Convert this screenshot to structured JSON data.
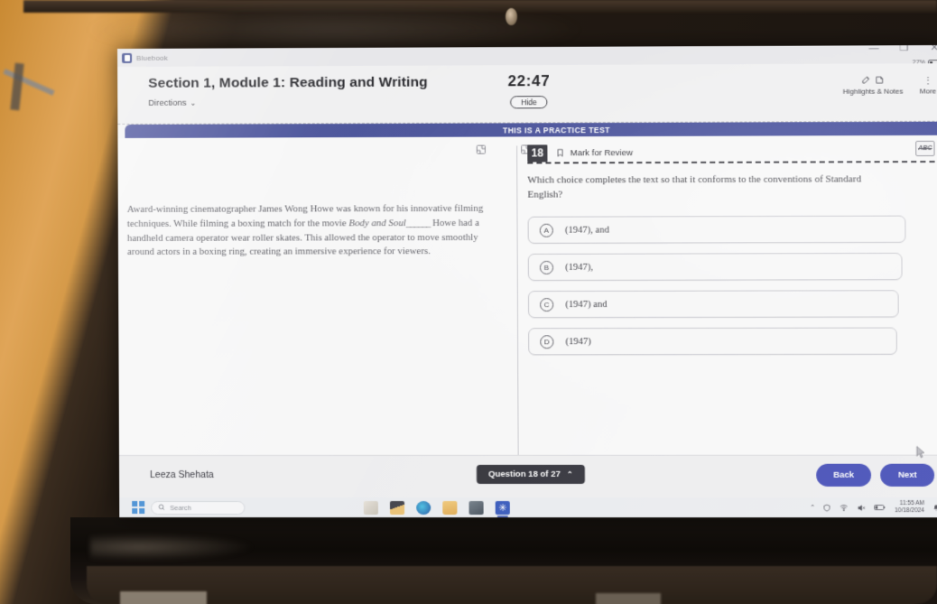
{
  "window": {
    "app_title": "Bluebook",
    "app_logo_icon": "bluebook-logo-icon",
    "minimize_label": "—",
    "maximize_label": "❐",
    "close_label": "✕",
    "battery_percent": "27%"
  },
  "header": {
    "section_title": "Section 1, Module 1: Reading and Writing",
    "directions_label": "Directions",
    "directions_chevron": "⌄",
    "timer": "22:47",
    "hide_label": "Hide",
    "highlights_notes_label": "Highlights & Notes",
    "highlights_icon": "highlighter-icon",
    "notes_icon": "note-icon",
    "more_label": "More",
    "more_icon": "more-vertical-icon"
  },
  "banner": {
    "text": "THIS IS A PRACTICE TEST"
  },
  "panes": {
    "expand_left_icon": "expand-panel-icon",
    "expand_right_icon": "collapse-panel-icon"
  },
  "passage": {
    "part1": "Award-winning cinematographer James Wong Howe was known for his innovative filming techniques. While filming a boxing match for the movie ",
    "italic1": "Body and Soul",
    "blank": "______",
    "part2": " Howe had a handheld camera operator wear roller skates. This allowed the operator to move smoothly around actors in a boxing ring, creating an immersive experience for viewers."
  },
  "question": {
    "number": "18",
    "mark_for_review_label": "Mark for Review",
    "bookmark_icon": "bookmark-icon",
    "abc_tool_label": "ABC",
    "abc_tool_icon": "strikethrough-abc-icon",
    "prompt": "Which choice completes the text so that it conforms to the conventions of Standard English?",
    "choices": [
      {
        "letter": "A",
        "text": "(1947), and"
      },
      {
        "letter": "B",
        "text": "(1947),"
      },
      {
        "letter": "C",
        "text": "(1947) and"
      },
      {
        "letter": "D",
        "text": "(1947)"
      }
    ]
  },
  "footer": {
    "student_name": "Leeza Shehata",
    "question_counter": "Question 18 of 27",
    "counter_chevron": "⌃",
    "back_label": "Back",
    "next_label": "Next"
  },
  "taskbar": {
    "start_icon": "windows-start-icon",
    "search_placeholder": "Search",
    "search_icon": "search-icon",
    "apps": [
      {
        "icon": "paint-icon"
      },
      {
        "icon": "file-explorer-icon"
      },
      {
        "icon": "edge-browser-icon"
      },
      {
        "icon": "folder-icon"
      },
      {
        "icon": "store-icon"
      },
      {
        "icon": "bluebook-app-icon"
      }
    ],
    "tray": {
      "overflow_icon": "chevron-up-icon",
      "defender_icon": "security-alert-icon",
      "wifi_icon": "wifi-icon",
      "volume_icon": "volume-muted-icon",
      "battery_icon": "battery-icon",
      "time": "11:55 AM",
      "date": "10/18/2024",
      "notification_icon": "notification-bell-icon"
    }
  },
  "pointer": {
    "cursor_icon": "mouse-pointer-icon"
  },
  "colors": {
    "accent_blue": "#3b46c4",
    "banner_blue": "#3f4aa0",
    "dark_chip": "#2b2b33"
  }
}
